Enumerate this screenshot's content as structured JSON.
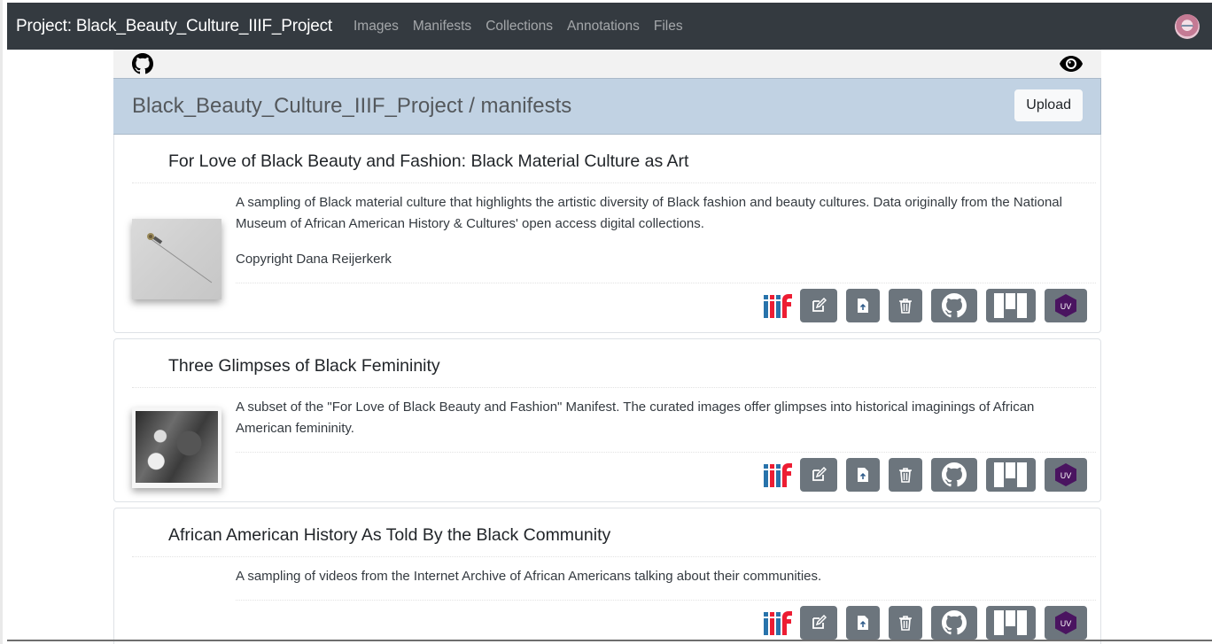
{
  "navbar": {
    "brand": "Project: Black_Beauty_Culture_IIIF_Project",
    "links": [
      "Images",
      "Manifests",
      "Collections",
      "Annotations",
      "Files"
    ],
    "avatar_icon": "user-avatar"
  },
  "toolbar": {
    "left_icon": "github-icon",
    "right_icon": "eye-icon"
  },
  "header": {
    "title": "Black_Beauty_Culture_IIIF_Project / manifests",
    "upload_label": "Upload"
  },
  "manifests": [
    {
      "title": "For Love of Black Beauty and Fashion: Black Material Culture as Art",
      "description": [
        "A sampling of Black material culture that highlights the artistic diversity of Black fashion and beauty cultures. Data originally from the National Museum of African American History & Cultures' open access digital collections.",
        "Copyright Dana Reijerkerk"
      ],
      "thumbnail": "hat-pin-image",
      "actions": [
        "iiif-logo",
        "edit",
        "upload-file",
        "delete",
        "github",
        "mirador",
        "universal-viewer"
      ]
    },
    {
      "title": "Three Glimpses of Black Femininity",
      "description": [
        "A subset of the \"For Love of Black Beauty and Fashion\" Manifest. The curated images offer glimpses into historical imaginings of African American femininity."
      ],
      "thumbnail": "black-and-white-photo",
      "actions": [
        "iiif-logo",
        "edit",
        "upload-file",
        "delete",
        "github",
        "mirador",
        "universal-viewer"
      ]
    },
    {
      "title": "African American History As Told By the Black Community",
      "description": [
        "A sampling of videos from the Internet Archive of African Americans talking about their communities."
      ],
      "thumbnail": null,
      "actions": [
        "iiif-logo",
        "edit",
        "upload-file",
        "delete",
        "github",
        "mirador",
        "universal-viewer"
      ]
    }
  ],
  "action_labels": {
    "uv": "UV"
  },
  "colors": {
    "navbar_bg": "#343a40",
    "header_bg": "#c1d2e3",
    "button_gray": "#6c757d",
    "uv_purple": "#4a1460",
    "iiif_blue": "#2873ab",
    "iiif_red": "#ed1d33"
  }
}
